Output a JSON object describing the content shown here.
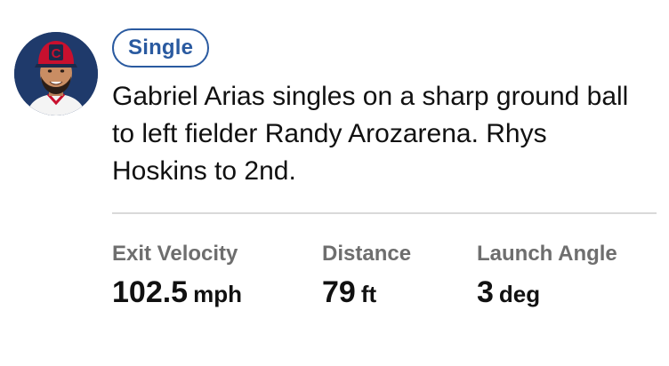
{
  "player": {
    "avatar_icon": "player-headshot",
    "cap_letter": "C"
  },
  "play": {
    "result_badge": "Single",
    "badge_color": "#2a5aa0",
    "description": "Gabriel Arias singles on a sharp ground ball to left fielder Randy Arozarena. Rhys Hoskins to 2nd."
  },
  "stats": [
    {
      "label": "Exit Velocity",
      "value": "102.5",
      "unit": "mph"
    },
    {
      "label": "Distance",
      "value": "79",
      "unit": "ft"
    },
    {
      "label": "Launch Angle",
      "value": "3",
      "unit": "deg"
    }
  ]
}
